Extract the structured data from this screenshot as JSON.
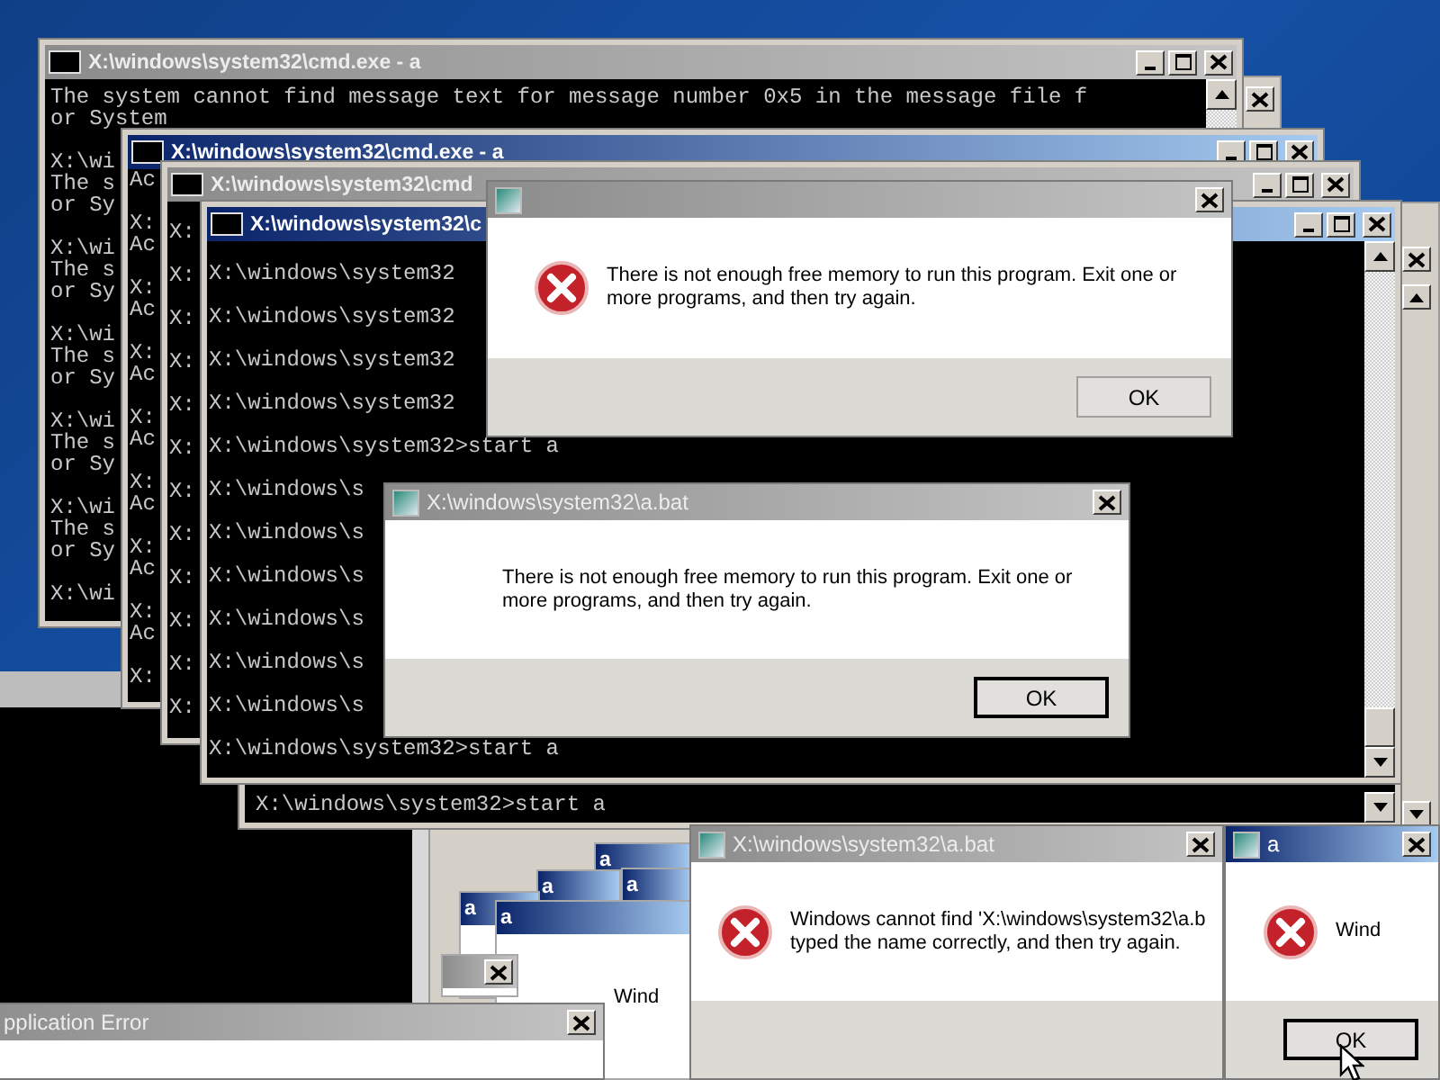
{
  "desktop": {
    "windows": [
      {
        "kind": "console",
        "blocks": [
          [
            "X:\\windows\\system32>start a"
          ]
        ]
      },
      {
        "kind": "console",
        "title": "X:\\windows\\system32\\cmd.exe - a",
        "active": false,
        "blocks": [
          [
            "The system cannot find message text for message number 0x5 in the message file f",
            "or System"
          ],
          [
            "X:\\wi",
            "The s",
            "or Sy"
          ],
          [
            "X:\\wi",
            "The s",
            "or Sy"
          ],
          [
            "X:\\wi",
            "The s",
            "or Sy"
          ],
          [
            "X:\\wi",
            "The s",
            "or Sy"
          ],
          [
            "X:\\wi",
            "The s",
            "or Sy"
          ],
          [
            "X:\\wi"
          ]
        ]
      },
      {
        "kind": "console",
        "title": "X:\\windows\\system32\\cmd.exe - a",
        "active": true,
        "blocks": [
          [
            "Ac"
          ],
          [
            "X:",
            "Ac"
          ],
          [
            "X:",
            "Ac"
          ],
          [
            "X:",
            "Ac"
          ],
          [
            "X:",
            "Ac"
          ],
          [
            "X:",
            "Ac"
          ],
          [
            "X:",
            "Ac"
          ],
          [
            "X:",
            "Ac"
          ],
          [
            "X:"
          ]
        ]
      },
      {
        "kind": "console",
        "title": "X:\\windows\\system32\\cmd",
        "active": false,
        "blocks": [
          [
            "X:"
          ],
          [
            "X:"
          ],
          [
            "X:"
          ],
          [
            "X:"
          ],
          [
            "X:"
          ],
          [
            "X:"
          ],
          [
            "X:"
          ],
          [
            "X:"
          ],
          [
            "X:"
          ],
          [
            "X:"
          ],
          [
            "X:"
          ],
          [
            "X:"
          ]
        ]
      },
      {
        "kind": "console",
        "title": "X:\\windows\\system32\\c",
        "active": true,
        "blocks": [
          [
            "X:\\windows\\system32"
          ],
          [
            "X:\\windows\\system32"
          ],
          [
            "X:\\windows\\system32"
          ],
          [
            "X:\\windows\\system32"
          ],
          [
            "X:\\windows\\system32>start a"
          ],
          [
            "X:\\windows\\s"
          ],
          [
            "X:\\windows\\s"
          ],
          [
            "X:\\windows\\s"
          ],
          [
            "X:\\windows\\s"
          ],
          [
            "X:\\windows\\s"
          ],
          [
            "X:\\windows\\s"
          ],
          [
            "X:\\windows\\system32>start a"
          ]
        ]
      },
      {
        "kind": "dialog",
        "active": false,
        "lines": [
          "There is not enough free memory to run this program. Exit one or",
          "more programs, and then try again."
        ],
        "button": "OK",
        "focused": false
      },
      {
        "kind": "dialog",
        "title": "X:\\windows\\system32\\a.bat",
        "active": false,
        "lines": [
          "There is not enough free memory to run this program. Exit one or",
          "more programs, and then try again."
        ],
        "button": "OK",
        "focused": true
      },
      {
        "kind": "mini",
        "active": false
      },
      {
        "kind": "mini",
        "title": "a",
        "active": true
      },
      {
        "kind": "mini",
        "title": "a",
        "active": true,
        "lines": [
          "Wind"
        ]
      },
      {
        "kind": "mini",
        "title": "a",
        "active": true
      },
      {
        "kind": "mini",
        "title": "a",
        "active": true
      },
      {
        "kind": "mini",
        "title": "a",
        "active": true
      },
      {
        "kind": "dialog",
        "title": "X:\\windows\\system32\\a.bat",
        "active": false,
        "lines": [
          "Windows cannot find 'X:\\windows\\system32\\a.b",
          "typed the name correctly, and then try again."
        ]
      },
      {
        "kind": "dialog",
        "title": "a",
        "active": true,
        "lines": [
          "Wind"
        ],
        "button": "OK",
        "focused": true
      },
      {
        "kind": "dialog",
        "title": "pplication Error",
        "active": false
      }
    ]
  }
}
